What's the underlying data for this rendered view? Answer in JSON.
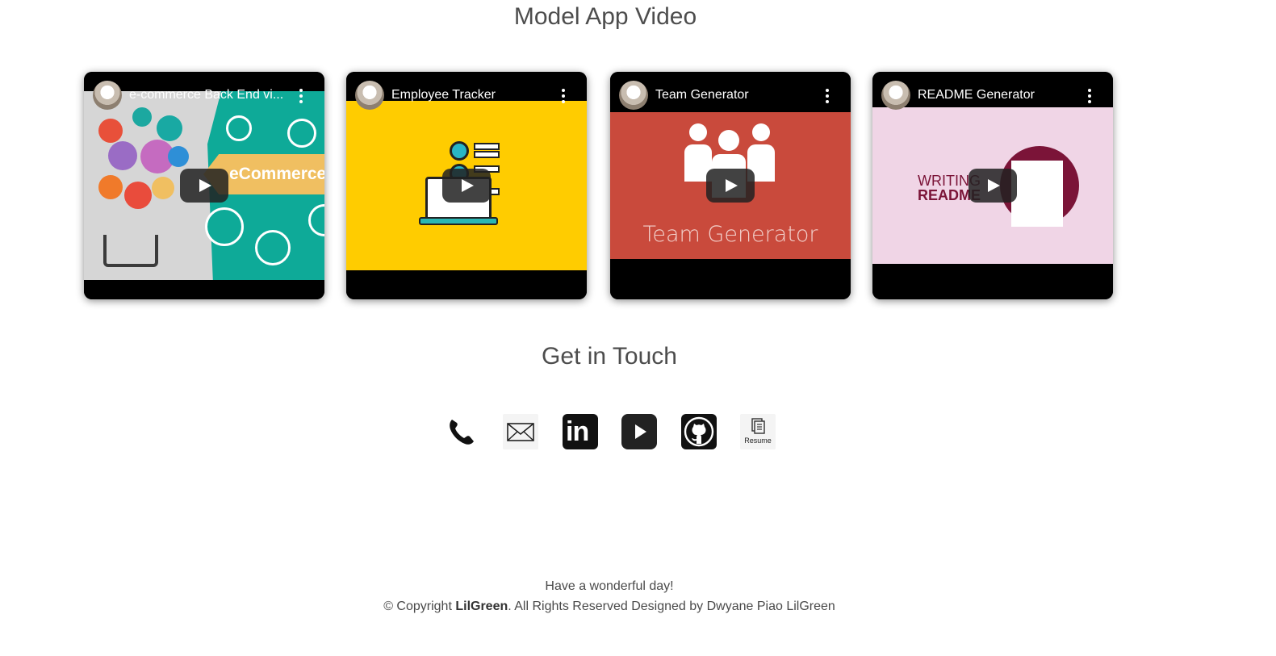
{
  "videos_section": {
    "title": "Model App Video",
    "videos": [
      {
        "title": "e-commerce Back End vi...",
        "thumb_text": "eCommerce |"
      },
      {
        "title": "Employee Tracker"
      },
      {
        "title": "Team Generator",
        "thumb_text": "Team Generator"
      },
      {
        "title": "README Generator",
        "thumb_text_1": "WRITING",
        "thumb_text_2": "README"
      }
    ]
  },
  "contact_section": {
    "title": "Get in Touch",
    "icons": [
      "phone-icon",
      "mail-icon",
      "linkedin-icon",
      "youtube-icon",
      "github-icon",
      "resume-icon"
    ],
    "linkedin_text": "in",
    "resume_text": "Resume"
  },
  "footer": {
    "greeting": "Have a wonderful day!",
    "copyright_prefix": "© Copyright ",
    "brand": "LilGreen",
    "copyright_suffix": ". All Rights Reserved Designed by Dwyane Piao LilGreen"
  },
  "colors": {
    "ecommerce_teal": "#0eaa98",
    "employee_yellow": "#ffcc00",
    "team_red": "#c94a3c",
    "readme_pink": "#f0d5e6"
  }
}
